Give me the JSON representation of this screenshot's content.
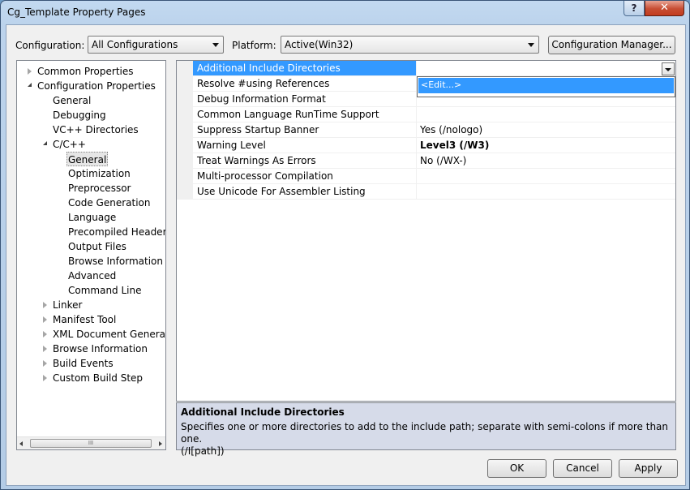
{
  "window": {
    "title": "Cg_Template Property Pages",
    "help_label": "?",
    "close_label": "✕"
  },
  "toolbar": {
    "configuration_label": "Configuration:",
    "configuration_value": "All Configurations",
    "platform_label": "Platform:",
    "platform_value": "Active(Win32)",
    "config_manager_label": "Configuration Manager..."
  },
  "tree": {
    "items": [
      {
        "label": "Common Properties",
        "state": "collapsed"
      },
      {
        "label": "Configuration Properties",
        "state": "expanded"
      },
      {
        "label": "General"
      },
      {
        "label": "Debugging"
      },
      {
        "label": "VC++ Directories"
      },
      {
        "label": "C/C++",
        "state": "expanded"
      },
      {
        "label": "General",
        "selected": true
      },
      {
        "label": "Optimization"
      },
      {
        "label": "Preprocessor"
      },
      {
        "label": "Code Generation"
      },
      {
        "label": "Language"
      },
      {
        "label": "Precompiled Headers"
      },
      {
        "label": "Output Files"
      },
      {
        "label": "Browse Information"
      },
      {
        "label": "Advanced"
      },
      {
        "label": "Command Line"
      },
      {
        "label": "Linker",
        "state": "collapsed"
      },
      {
        "label": "Manifest Tool",
        "state": "collapsed"
      },
      {
        "label": "XML Document Generator",
        "state": "collapsed"
      },
      {
        "label": "Browse Information",
        "state": "collapsed"
      },
      {
        "label": "Build Events",
        "state": "collapsed"
      },
      {
        "label": "Custom Build Step",
        "state": "collapsed"
      }
    ],
    "scroll_grip": "III"
  },
  "grid": {
    "rows": [
      {
        "name": "Additional Include Directories",
        "value": "",
        "selected": true
      },
      {
        "name": "Resolve #using References",
        "value": ""
      },
      {
        "name": "Debug Information Format",
        "value": ""
      },
      {
        "name": "Common Language RunTime Support",
        "value": ""
      },
      {
        "name": "Suppress Startup Banner",
        "value": "Yes (/nologo)"
      },
      {
        "name": "Warning Level",
        "value": "Level3 (/W3)",
        "bold": true
      },
      {
        "name": "Treat Warnings As Errors",
        "value": "No (/WX-)"
      },
      {
        "name": "Multi-processor Compilation",
        "value": ""
      },
      {
        "name": "Use Unicode For Assembler Listing",
        "value": ""
      }
    ],
    "dropdown_item": "<Edit...>"
  },
  "description": {
    "title": "Additional Include Directories",
    "text": "Specifies one or more directories to add to the include path; separate with semi-colons if more than one.",
    "text2": "(/I[path])"
  },
  "buttons": {
    "ok": "OK",
    "cancel": "Cancel",
    "apply": "Apply"
  }
}
